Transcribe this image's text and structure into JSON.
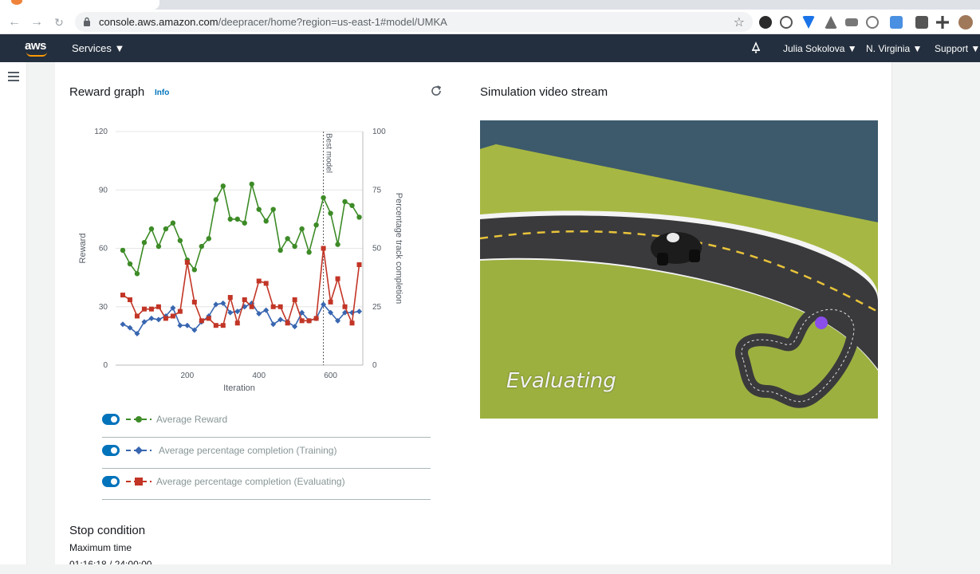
{
  "browser": {
    "url_host": "console.aws.amazon.com",
    "url_path": "/deepracer/home?region=us-east-1#model/UMKA"
  },
  "aws_nav": {
    "logo_text": "aws",
    "services": "Services ▼",
    "user": "Julia Sokolova ▼",
    "region": "N. Virginia ▼",
    "support": "Support ▼"
  },
  "reward_panel": {
    "title": "Reward graph",
    "info_link": "Info"
  },
  "simulation_panel": {
    "title": "Simulation video stream",
    "overlay_text": "Evaluating"
  },
  "chart_data": {
    "type": "line",
    "xlabel": "Iteration",
    "ylabel_left": "Reward",
    "ylabel_right": "Percentage track completion",
    "xlim": [
      0,
      690
    ],
    "ylim_left": [
      0,
      120
    ],
    "ylim_right": [
      0,
      100
    ],
    "x_ticks": [
      200,
      400,
      600
    ],
    "y_ticks_left": [
      0,
      30,
      60,
      90,
      120
    ],
    "y_ticks_right": [
      0,
      25,
      50,
      75,
      100
    ],
    "marker_line": {
      "x": 580,
      "label": "Best model"
    },
    "series": [
      {
        "name": "Average Reward",
        "color": "#3d8b27",
        "marker": "circle",
        "axis": "left",
        "x": [
          20,
          40,
          60,
          80,
          100,
          120,
          140,
          160,
          180,
          200,
          220,
          240,
          260,
          280,
          300,
          320,
          340,
          360,
          380,
          400,
          420,
          440,
          460,
          480,
          500,
          520,
          540,
          560,
          580,
          600,
          620,
          640,
          660,
          680
        ],
        "values": [
          59,
          52,
          47,
          63,
          70,
          61,
          70,
          73,
          64,
          54,
          49,
          61,
          65,
          85,
          92,
          75,
          75,
          73,
          93,
          80,
          74,
          80,
          59,
          65,
          61,
          70,
          58,
          72,
          86,
          78,
          62,
          84,
          82,
          76
        ]
      },
      {
        "name": "Average percentage completion (Training)",
        "color": "#3866b0",
        "marker": "diamond",
        "axis": "right",
        "x": [
          20,
          40,
          60,
          80,
          100,
          120,
          140,
          160,
          180,
          200,
          220,
          240,
          260,
          280,
          300,
          320,
          340,
          360,
          380,
          400,
          420,
          440,
          460,
          480,
          500,
          520,
          540,
          560,
          580,
          600,
          620,
          640,
          660,
          680
        ],
        "values": [
          17.5,
          16,
          13.5,
          18.5,
          20,
          19.5,
          21,
          24.5,
          17,
          17,
          15,
          18.5,
          21,
          26,
          26.5,
          22.5,
          23,
          25,
          26.5,
          22,
          23.5,
          17.5,
          19.5,
          18.5,
          16.5,
          22.5,
          19,
          20,
          26,
          22.5,
          19,
          22.5,
          22.5,
          23
        ]
      },
      {
        "name": "Average percentage completion (Evaluating)",
        "color": "#c23526",
        "marker": "square",
        "axis": "right",
        "x": [
          20,
          40,
          60,
          80,
          100,
          120,
          140,
          160,
          180,
          200,
          220,
          240,
          260,
          280,
          300,
          320,
          340,
          360,
          380,
          400,
          420,
          440,
          460,
          480,
          500,
          520,
          540,
          560,
          580,
          600,
          620,
          640,
          660,
          680
        ],
        "values": [
          30,
          28,
          21,
          24,
          24,
          25,
          20,
          21,
          23,
          44,
          27,
          19,
          20,
          17,
          17,
          29,
          18,
          28,
          25,
          36,
          35,
          25,
          25,
          18,
          28,
          19,
          19,
          20,
          50,
          27,
          37,
          25,
          18,
          43
        ]
      }
    ]
  },
  "legend": [
    {
      "label": "Average Reward",
      "color": "#3d8b27",
      "marker": "circle",
      "enabled": true
    },
    {
      "label": "Average percentage completion (Training)",
      "color": "#3866b0",
      "marker": "diamond",
      "enabled": true
    },
    {
      "label": "Average percentage completion (Evaluating)",
      "color": "#c23526",
      "marker": "square",
      "enabled": true
    }
  ],
  "stop_condition": {
    "title": "Stop condition",
    "label": "Maximum time",
    "value": "01:16:18 / 24:00:00"
  }
}
